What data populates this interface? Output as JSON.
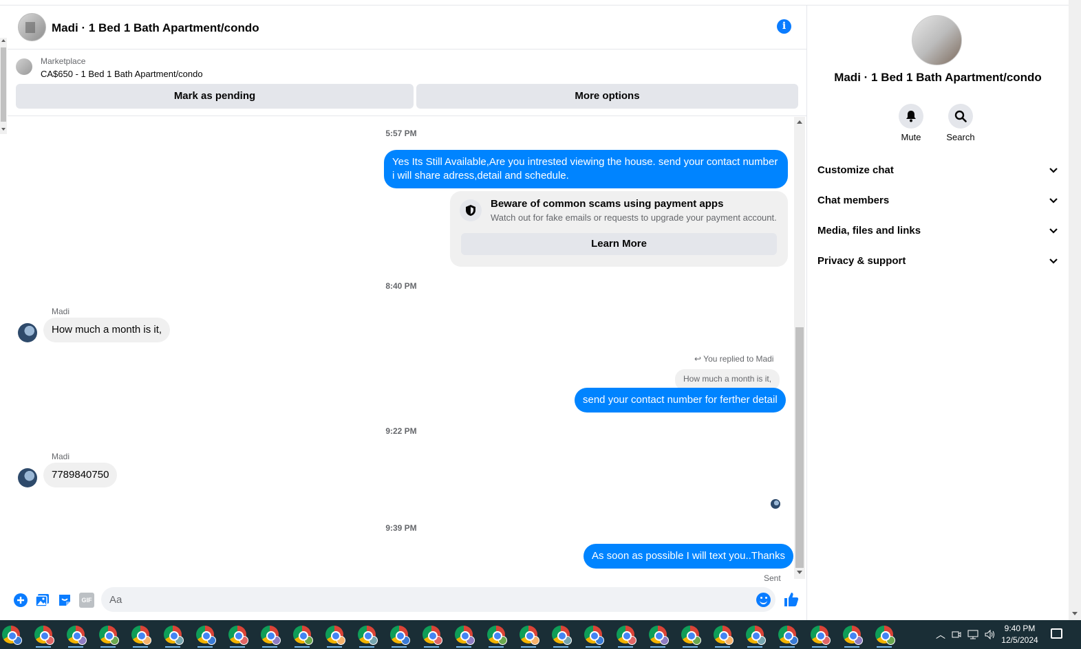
{
  "header": {
    "title": "Madi · 1 Bed 1 Bath Apartment/condo"
  },
  "marketplace": {
    "label": "Marketplace",
    "listing": "CA$650 - 1 Bed 1 Bath Apartment/condo",
    "mark_pending": "Mark as pending",
    "more_options": "More options"
  },
  "messages": {
    "ts1": "5:57 PM",
    "out1": "Yes Its Still Available,Are you intrested viewing the house. send your contact number i will share adress,detail and schedule.",
    "scam_title": "Beware of common scams using payment apps",
    "scam_desc": "Watch out for fake emails or requests to upgrade your payment account.",
    "learn_more": "Learn More",
    "ts2": "8:40 PM",
    "sender1": "Madi",
    "in1": "How much a month is it,",
    "replied_label": "You replied to Madi",
    "quote": "How much a month is it,",
    "out2": "send your contact number for ferther detail",
    "ts3": "9:22 PM",
    "sender2": "Madi",
    "in2": "7789840750",
    "ts4": "9:39 PM",
    "out3": "As soon as possible I will text you..Thanks",
    "sent": "Sent"
  },
  "composer": {
    "placeholder": "Aa",
    "gif": "GIF"
  },
  "side": {
    "name": "Madi · 1 Bed 1 Bath Apartment/condo",
    "mute": "Mute",
    "search": "Search",
    "sections": [
      "Customize chat",
      "Chat members",
      "Media, files and links",
      "Privacy & support"
    ]
  },
  "taskbar": {
    "time": "9:40 PM",
    "date": "12/5/2024",
    "app_icon_count": 28
  },
  "colors": {
    "accent": "#0084ff",
    "taskbar": "#1a2e36"
  }
}
